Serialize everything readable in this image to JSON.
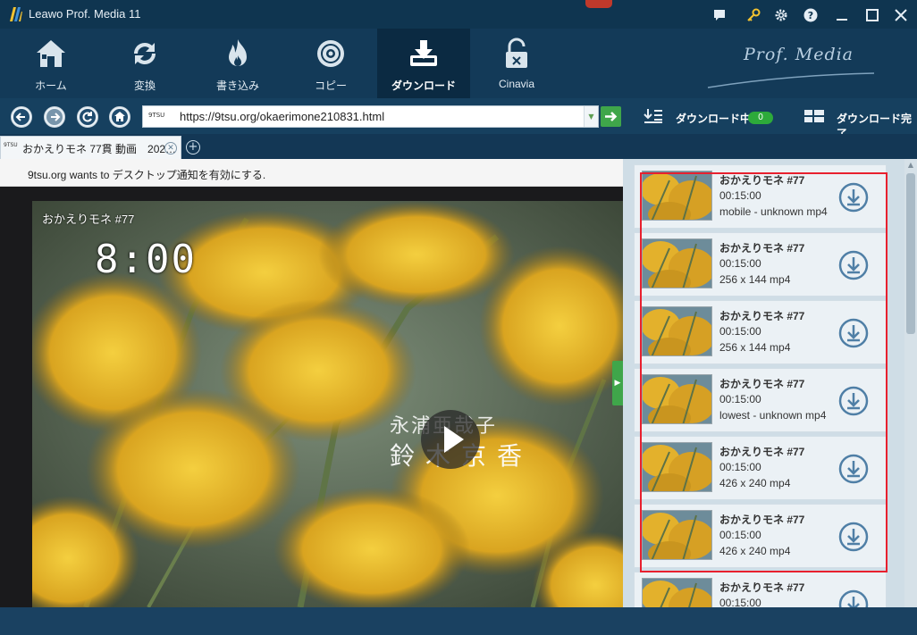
{
  "app": {
    "title": "Leawo Prof. Media 11"
  },
  "window_controls": [
    "chat-icon",
    "key-icon",
    "gear-icon",
    "help-icon",
    "minimize-icon",
    "maximize-icon",
    "close-icon"
  ],
  "toolbar": {
    "items": [
      {
        "label": "ホーム",
        "icon": "home-icon"
      },
      {
        "label": "変換",
        "icon": "convert-icon"
      },
      {
        "label": "書き込み",
        "icon": "burn-icon"
      },
      {
        "label": "コピー",
        "icon": "copy-disc-icon"
      },
      {
        "label": "ダウンロード",
        "icon": "download-icon",
        "active": true
      },
      {
        "label": "Cinavia",
        "icon": "cinavia-lock-icon"
      }
    ],
    "brand_logo": "Prof. Media"
  },
  "addressbar": {
    "url": "https://9tsu.org/okaerimone210831.html",
    "favicon": "9TSU",
    "downloading_label": "ダウンロード中",
    "downloading_count": "0",
    "completed_label": "ダウンロード完了"
  },
  "tab": {
    "favicon": "9TSU",
    "title": "おかえりモネ  77貫 動画　202…"
  },
  "notification": {
    "text": "9tsu.org wants to デスクトップ通知を有効にする."
  },
  "video": {
    "title": "おかえりモネ #77",
    "clock": "8:00",
    "credit_line1": "永浦亜哉子",
    "credit_line2": "鈴木京香"
  },
  "download_list": [
    {
      "title": "おかえりモネ #77",
      "duration": "00:15:00",
      "format": "mobile - unknown mp4"
    },
    {
      "title": "おかえりモネ #77",
      "duration": "00:15:00",
      "format": "256 x 144 mp4"
    },
    {
      "title": "おかえりモネ #77",
      "duration": "00:15:00",
      "format": "256 x 144 mp4"
    },
    {
      "title": "おかえりモネ #77",
      "duration": "00:15:00",
      "format": "lowest - unknown mp4"
    },
    {
      "title": "おかえりモネ #77",
      "duration": "00:15:00",
      "format": "426 x 240 mp4"
    },
    {
      "title": "おかえりモネ #77",
      "duration": "00:15:00",
      "format": "426 x 240 mp4"
    },
    {
      "title": "おかえりモネ #77",
      "duration": "00:15:00",
      "format": ""
    }
  ],
  "colors": {
    "accent_green": "#3fa64a",
    "highlight_red": "#e8202e",
    "toolbar_bg": "#133a58",
    "active_tab_bg": "#0b2a42"
  }
}
